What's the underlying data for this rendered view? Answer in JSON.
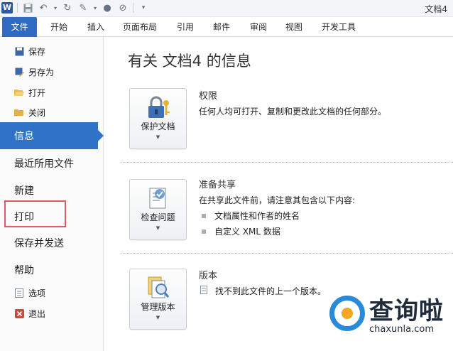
{
  "window": {
    "title": "文档4"
  },
  "ribbon": {
    "tabs": [
      {
        "label": "文件"
      },
      {
        "label": "开始"
      },
      {
        "label": "插入"
      },
      {
        "label": "页面布局"
      },
      {
        "label": "引用"
      },
      {
        "label": "邮件"
      },
      {
        "label": "审阅"
      },
      {
        "label": "视图"
      },
      {
        "label": "开发工具"
      }
    ]
  },
  "nav": {
    "save": "保存",
    "save_as": "另存为",
    "open": "打开",
    "close": "关闭",
    "info": "信息",
    "recent": "最近所用文件",
    "new": "新建",
    "print": "打印",
    "save_send": "保存并发送",
    "help": "帮助",
    "options": "选项",
    "exit": "退出"
  },
  "main": {
    "title": "有关 文档4 的信息",
    "permissions": {
      "button": "保护文档",
      "title": "权限",
      "desc": "任何人均可打开、复制和更改此文档的任何部分。"
    },
    "prepare": {
      "button": "检查问题",
      "title": "准备共享",
      "desc": "在共享此文件前，请注意其包含以下内容:",
      "items": [
        "文档属性和作者的姓名",
        "自定义 XML 数据"
      ]
    },
    "versions": {
      "button": "管理版本",
      "title": "版本",
      "desc": "找不到此文件的上一个版本。"
    }
  },
  "watermark": {
    "brand": "查询啦",
    "url": "chaxunla.com"
  },
  "colors": {
    "accent": "#2f72c8",
    "file_tab": "#2f6bc2",
    "highlight_box": "#e05a5a"
  }
}
